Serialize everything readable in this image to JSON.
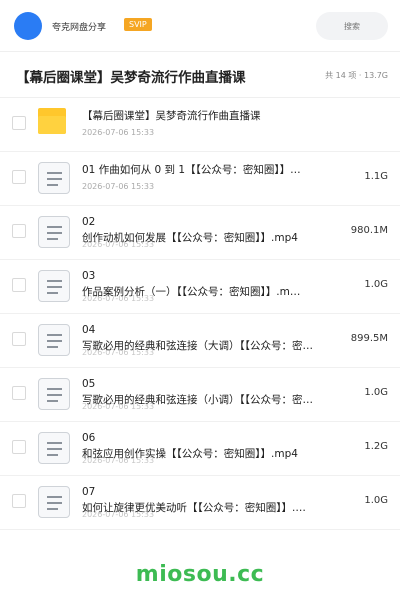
{
  "header": {
    "brand": "夸克网盘分享",
    "badge": "SVIP",
    "search_placeholder": "搜索",
    "accent": "#2a7cf4",
    "badge_color": "#f5a623"
  },
  "share": {
    "title": "【幕后圈课堂】吴梦奇流行作曲直播课",
    "meta": "共 14 项 · 13.7G"
  },
  "folder": {
    "name": "【幕后圈课堂】吴梦奇流行作曲直播课",
    "date": "2026-07-06 15:33",
    "icon": "folder-icon"
  },
  "files": [
    {
      "line1": "01 作曲如何从 0 到 1【【公众号：密知圈】】…",
      "line2": "",
      "date": "2026-07-06 15:33",
      "size": "1.1G"
    },
    {
      "line1": "02",
      "line2": "创作动机如何发展【【公众号：密知圈】】.mp4",
      "date": "2026-07-06 15:33",
      "size": "980.1M"
    },
    {
      "line1": "03",
      "line2": "作品案例分析（一）【【公众号：密知圈】】.m…",
      "date": "2026-07-06 15:33",
      "size": "1.0G"
    },
    {
      "line1": "04",
      "line2": "写歌必用的经典和弦连接（大调）【【公众号：密…",
      "date": "2026-07-06 15:33",
      "size": "899.5M"
    },
    {
      "line1": "05",
      "line2": "写歌必用的经典和弦连接（小调）【【公众号：密…",
      "date": "2026-07-06 15:33",
      "size": "1.0G"
    },
    {
      "line1": "06",
      "line2": "和弦应用创作实操【【公众号：密知圈】】.mp4",
      "date": "2026-07-06 15:33",
      "size": "1.2G"
    },
    {
      "line1": "07",
      "line2": "如何让旋律更优美动听【【公众号：密知圈】】.…",
      "date": "2026-07-06 15:33",
      "size": "1.0G"
    }
  ],
  "watermark": {
    "text": "miosou.cc",
    "color": "#3dbb53"
  }
}
